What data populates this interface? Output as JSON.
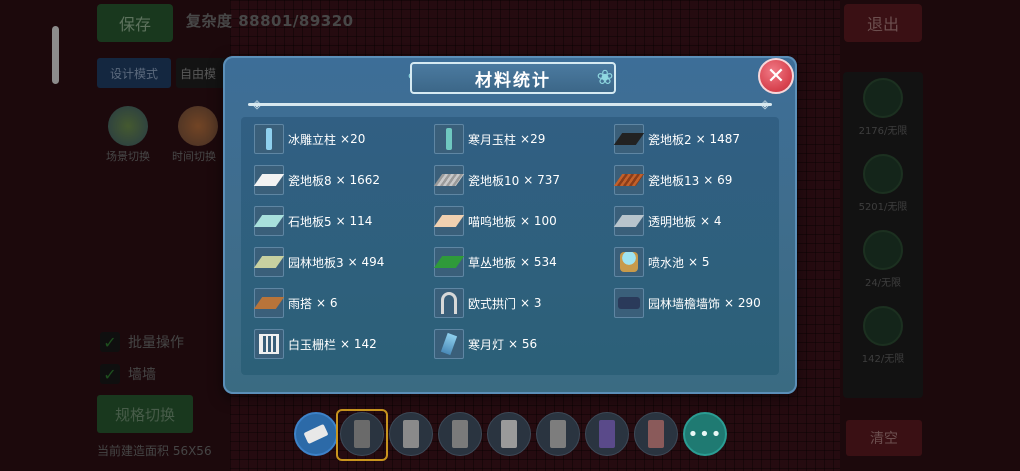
{
  "background": {
    "save_label": "保存",
    "complexity_text": "复杂度 88801/89320",
    "design_mode_label": "设计模式",
    "free_mode_label": "自由模",
    "scene_switch_label": "场景切换",
    "time_switch_label": "时间切换",
    "batch_op_label": "批量操作",
    "wall_label": "墙墙",
    "spec_switch_label": "规格切换",
    "area_text": "当前建造面积 56X56",
    "exit_label": "退出",
    "clear_label": "清空",
    "side_items": [
      {
        "count": "2176/无限"
      },
      {
        "count": "5201/无限"
      },
      {
        "count": "24/无限"
      },
      {
        "count": "142/无限"
      }
    ]
  },
  "toolbar": {
    "more_label": "•••"
  },
  "modal": {
    "title": "材料统计",
    "close_label": "✕",
    "materials": [
      {
        "name": "冰雕立柱",
        "qty": "×20"
      },
      {
        "name": "寒月玉柱",
        "qty": "×29"
      },
      {
        "name": "瓷地板2",
        "qty": "× 1487"
      },
      {
        "name": "瓷地板8",
        "qty": "× 1662"
      },
      {
        "name": "瓷地板10",
        "qty": "× 737"
      },
      {
        "name": "瓷地板13",
        "qty": "× 69"
      },
      {
        "name": "石地板5",
        "qty": "× 114"
      },
      {
        "name": "喵呜地板",
        "qty": "× 100"
      },
      {
        "name": "透明地板",
        "qty": "× 4"
      },
      {
        "name": "园林地板3",
        "qty": "× 494"
      },
      {
        "name": "草丛地板",
        "qty": "× 534"
      },
      {
        "name": "喷水池",
        "qty": "× 5"
      },
      {
        "name": "雨搭",
        "qty": "× 6"
      },
      {
        "name": "欧式拱门",
        "qty": "× 3"
      },
      {
        "name": "园林墙檐墙饰",
        "qty": "× 290"
      },
      {
        "name": "白玉栅栏",
        "qty": "× 142"
      },
      {
        "name": "寒月灯",
        "qty": "× 56"
      }
    ]
  },
  "colors": {
    "modal_bg": "#3d6e98",
    "close_red": "#d8434f",
    "save_green": "#27562f",
    "exit_red": "#5a1a1f"
  }
}
